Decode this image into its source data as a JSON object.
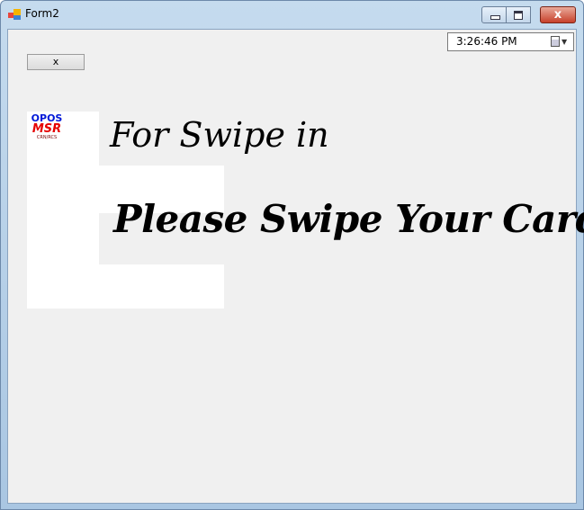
{
  "window": {
    "title": "Form2",
    "close_glyph": "x"
  },
  "toolbar": {
    "x_button_label": "x",
    "time_value": "3:26:46 PM"
  },
  "logo": {
    "line1": "OPOS",
    "line2": "MSR",
    "line3": "CRN/RCS"
  },
  "main": {
    "heading": "For Swipe in",
    "message": "Please Swipe Your Card"
  },
  "colors": {
    "logo_blue": "#0018d8",
    "logo_red": "#e60000",
    "form_background": "#f0f0f0"
  },
  "icons": {
    "app": "form-app-icon",
    "calendar": "calendar-icon",
    "dropdown": "chevron-down-icon"
  }
}
